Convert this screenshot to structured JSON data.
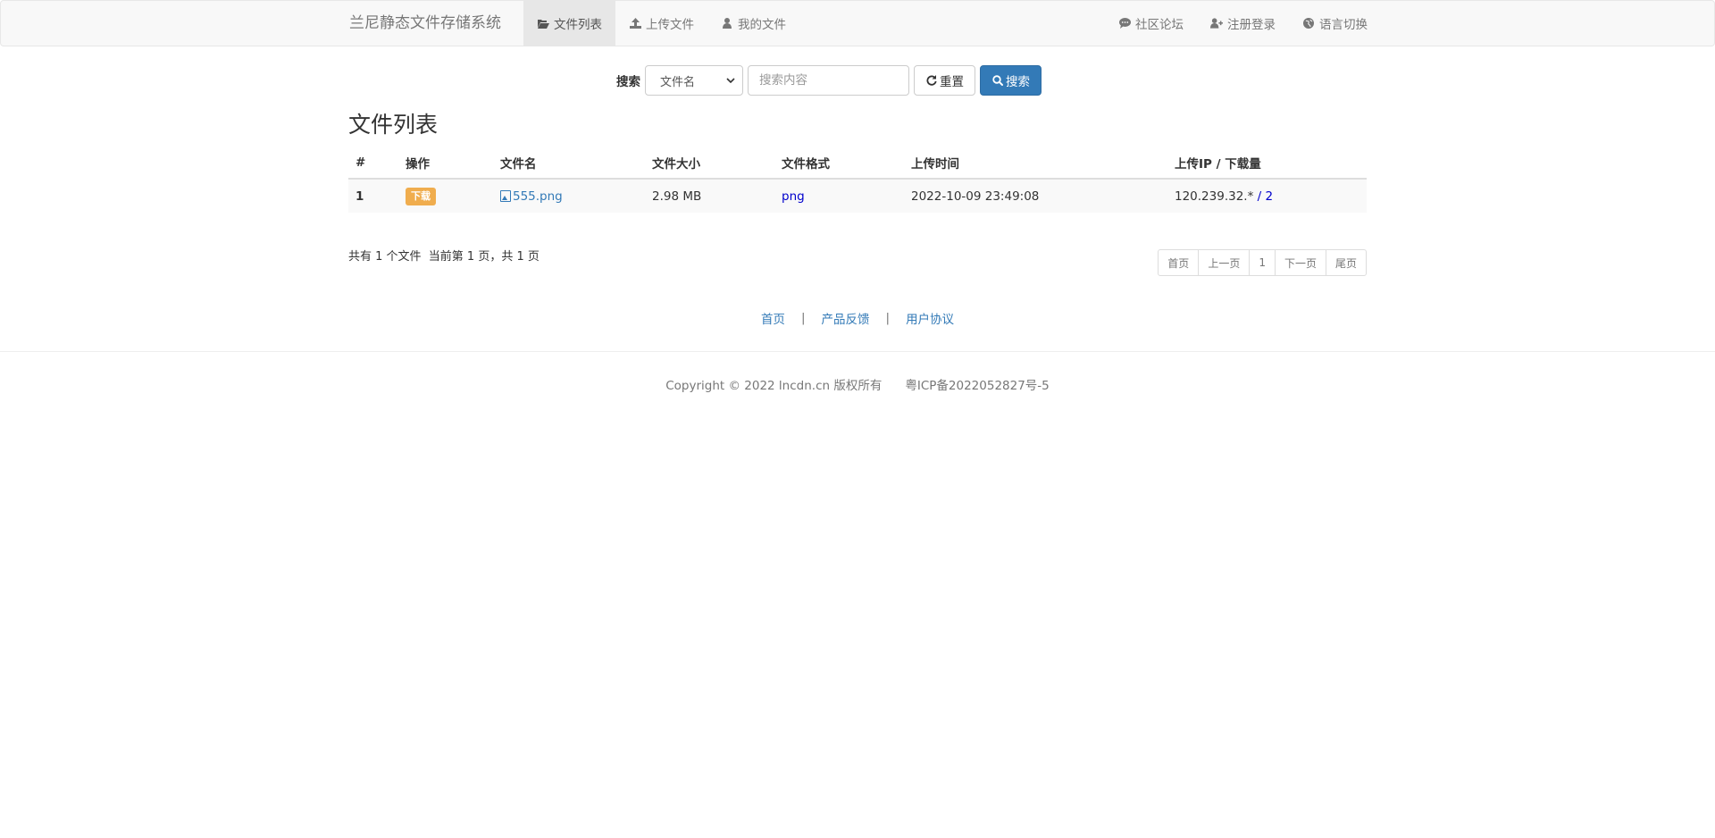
{
  "navbar": {
    "brand": "兰尼静态文件存储系统",
    "left_items": [
      {
        "label": "文件列表",
        "icon": "folder-open-icon",
        "active": true
      },
      {
        "label": "上传文件",
        "icon": "upload-icon",
        "active": false
      },
      {
        "label": "我的文件",
        "icon": "user-icon",
        "active": false
      }
    ],
    "right_items": [
      {
        "label": "社区论坛",
        "icon": "comment-icon"
      },
      {
        "label": "注册登录",
        "icon": "user-add-icon"
      },
      {
        "label": "语言切换",
        "icon": "globe-icon"
      }
    ]
  },
  "search": {
    "label": "搜索",
    "field_select": "文件名",
    "placeholder": "搜索内容",
    "reset_label": "重置",
    "search_label": "搜索"
  },
  "page_title": "文件列表",
  "table": {
    "headers": [
      "#",
      "操作",
      "文件名",
      "文件大小",
      "文件格式",
      "上传时间",
      "上传IP / 下载量"
    ],
    "rows": [
      {
        "index": "1",
        "action": "下载",
        "filename": "555.png",
        "size": "2.98 MB",
        "format": "png",
        "upload_time": "2022-10-09 23:49:08",
        "ip": "120.239.32.*",
        "ip_sep": " / ",
        "downloads": "2"
      }
    ]
  },
  "summary": "共有 1 个文件  当前第 1 页，共 1 页",
  "pager": [
    "首页",
    "上一页",
    "1",
    "下一页",
    "尾页"
  ],
  "footer": {
    "links": [
      "首页",
      "产品反馈",
      "用户协议"
    ],
    "separator": "|",
    "copyright": "Copyright © 2022 lncdn.cn 版权所有",
    "icp": "粤ICP备2022052827号-5"
  },
  "colors": {
    "primary": "#337ab7",
    "warning": "#f0ad4e",
    "format_link": "#0000cc"
  }
}
